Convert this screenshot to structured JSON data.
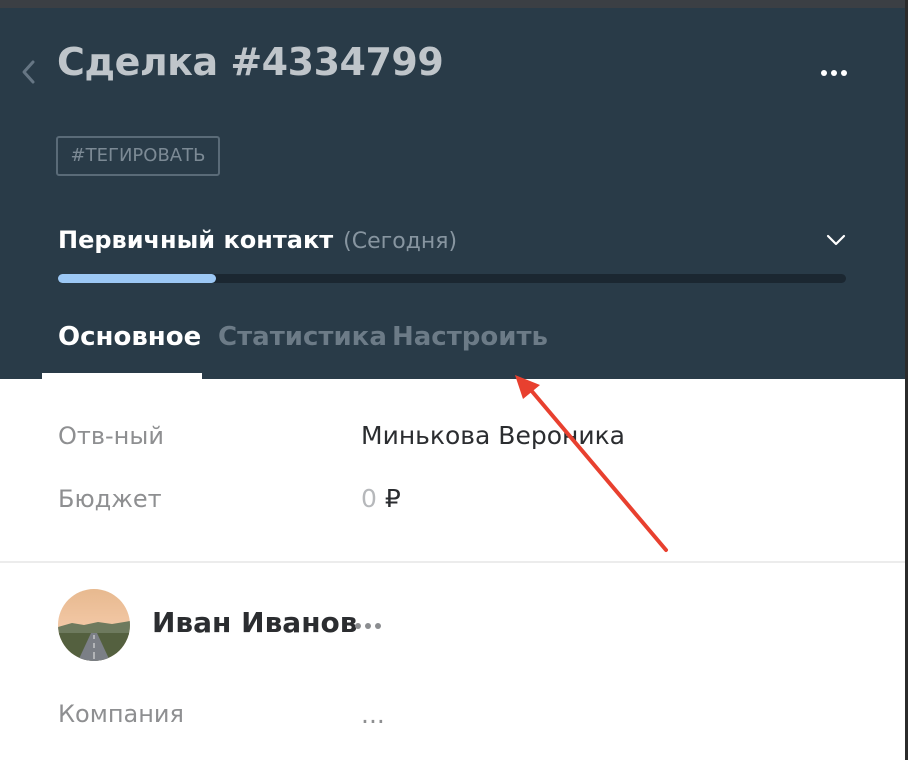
{
  "deal": {
    "title": "Сделка #4334799",
    "tag_button": "#ТЕГИРОВАТЬ",
    "stage": {
      "name": "Первичный контакт",
      "when": "(Сегодня)",
      "progress": 0.2
    }
  },
  "tabs": [
    "Основное",
    "Статистика",
    "Настроить"
  ],
  "fields": {
    "responsible": {
      "label": "Отв-ный",
      "value": "Минькова Вероника"
    },
    "budget": {
      "label": "Бюджет",
      "amount": "0",
      "currency": "₽"
    }
  },
  "contact": {
    "name": "Иван Иванов",
    "company": {
      "label": "Компания",
      "value": "..."
    }
  },
  "icons": {
    "back": "chevron-left-icon",
    "menu": "more-horizontal-icon",
    "stage_toggle": "chevron-down-icon",
    "annotation": "red-arrow-icon"
  },
  "colors": {
    "header_bg": "#293b48",
    "progress_fill": "#9cc8f5",
    "annotation_arrow": "#e8402f"
  }
}
